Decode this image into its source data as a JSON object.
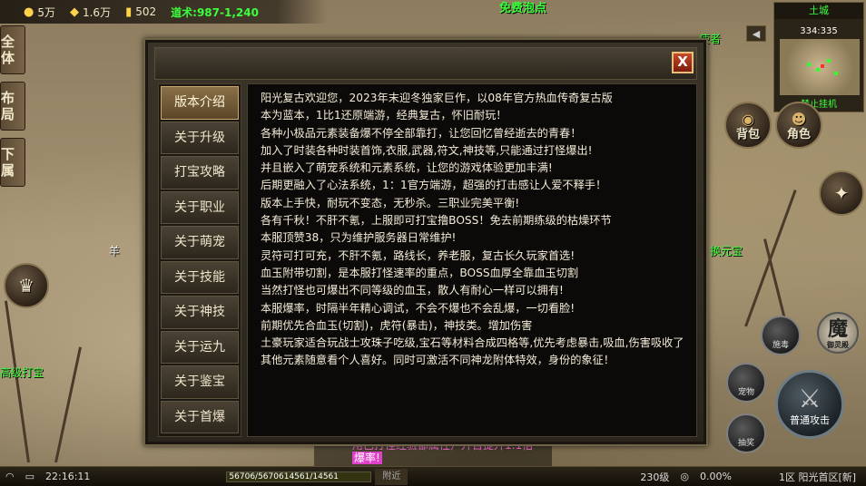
{
  "topbar": {
    "gold": "5万",
    "yuanbao": "1.6万",
    "lingfu": "502",
    "daoshu": "道术:987-1,240"
  },
  "top_label": "免费泡点",
  "left_tabs": [
    {
      "label": "全体"
    },
    {
      "label": "布局"
    },
    {
      "label": "下属"
    }
  ],
  "minimap": {
    "title": "土城",
    "coords": "334:335",
    "label": "禁止挂机"
  },
  "buttons": {
    "bag": "背包",
    "character": "角色",
    "attack": "普通攻击",
    "moju_char": "魔",
    "moju_sub": "御灵殿",
    "skill_a": "施毒",
    "skill_b": "宠物",
    "skill_c": "抽奖"
  },
  "world_labels": {
    "npc_right": "使者",
    "npc_right2": "换元宝",
    "sheep": "羊",
    "left_gold": "高级打宝"
  },
  "dialog": {
    "close_label": "X",
    "nav": [
      {
        "label": "版本介绍",
        "active": true
      },
      {
        "label": "关于升级"
      },
      {
        "label": "打宝攻略"
      },
      {
        "label": "关于职业"
      },
      {
        "label": "关于萌宠"
      },
      {
        "label": "关于技能"
      },
      {
        "label": "关于神技"
      },
      {
        "label": "关于运九"
      },
      {
        "label": "关于鉴宝"
      },
      {
        "label": "关于首爆"
      }
    ],
    "lines": [
      "阳光复古欢迎您，2023年末迎冬独家巨作，以08年官方热血传奇复古版",
      "本为蓝本，1比1还原端游，经典复古，怀旧耐玩！",
      "各种小极品元素装备爆不停全部靠打，让您回忆曾经逝去的青春！",
      "加入了时装各种时装首饰,衣服,武器,符文,神技等,只能通过打怪爆出!",
      "并且嵌入了萌宠系统和元素系统，让您的游戏体验更加丰满!",
      "后期更融入了心法系统，1：1官方端游，超强的打击感让人爱不释手！",
      "版本上手快，耐玩不变态，无秒杀。三职业完美平衡!",
      "各有千秋！不肝不氪，上服即可打宝撸BOSS！免去前期练级的枯燥环节",
      "本服顶赞38，只为维护服务器日常维护!",
      "灵符可打可充，不肝不氪，路线长，养老服，复古长久玩家首选!",
      "血玉附带切割，是本服打怪速率的重点，BOSS血厚全靠血玉切割",
      "当然打怪也可爆出不同等级的血玉，散人有耐心一样可以拥有!",
      "本服爆率，时隔半年精心调试，不会不爆也不会乱爆，一切看脸!",
      "前期优先合血玉(切割)，虎符(暴击)，神技类。增加伤害",
      "土豪玩家适合玩战士攻珠子吃级,宝石等材料合成四格等,优先考虑暴击,吸血,伤害吸收了",
      "其他元素随意看个人喜好。同时可激活不同神龙附体特效，身份的象征！"
    ]
  },
  "chat": {
    "line1": "用已打怪经验都属性）升百提升1:1倍",
    "line2": "爆率!"
  },
  "bottombar": {
    "time": "22:16:11",
    "hp": "56706/56706",
    "mp": "14561/14561",
    "nearby": "附近",
    "level": "230级",
    "exp": "0.00%",
    "server": "1区 阳光首区[新]"
  },
  "colors": {
    "green_text": "#3cff3c",
    "dialog_bg": "#2a251c",
    "content_bg": "#0c0a08",
    "active_tab": "#8a7048",
    "close_red": "#c84a2a"
  }
}
